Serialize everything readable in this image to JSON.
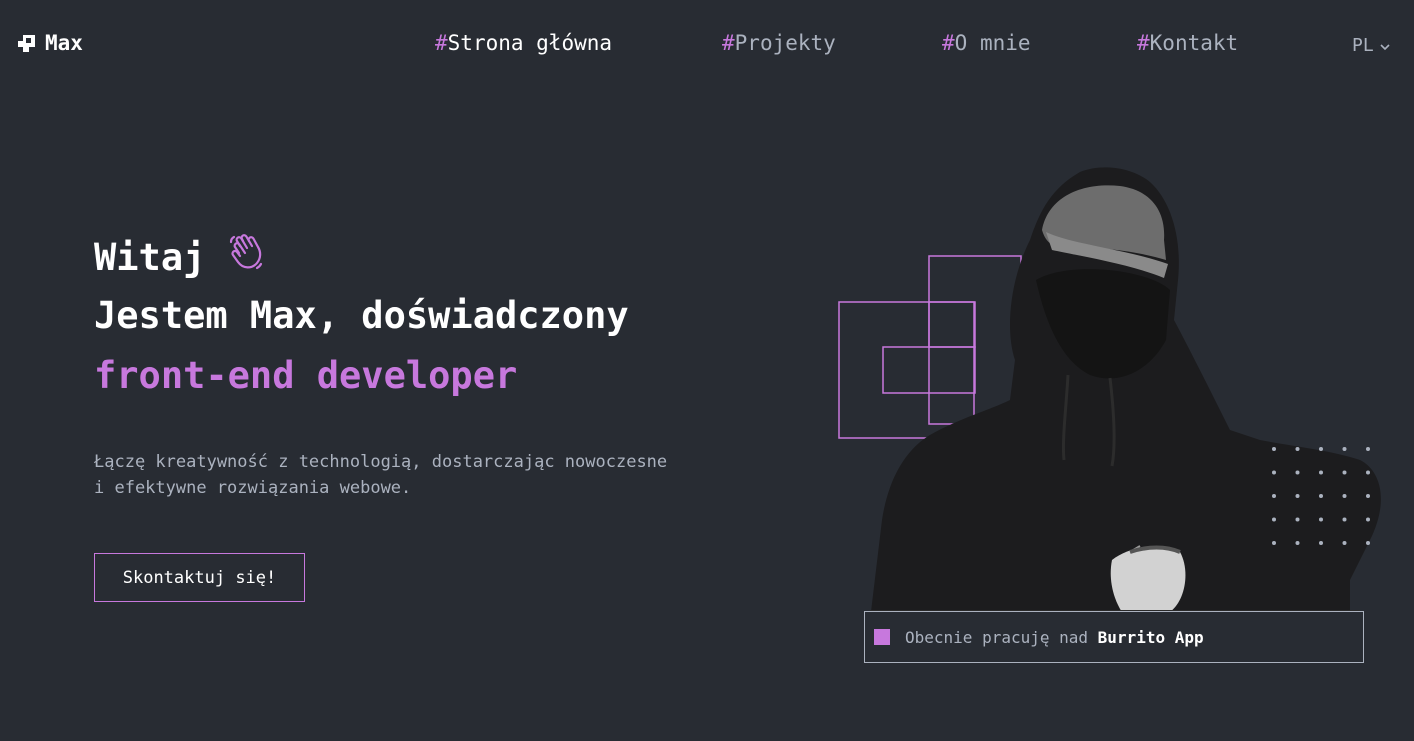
{
  "header": {
    "logo_text": "Max",
    "nav": [
      {
        "hash": "#",
        "label": "Strona główna"
      },
      {
        "hash": "#",
        "label": "Projekty"
      },
      {
        "hash": "#",
        "label": "O mnie"
      },
      {
        "hash": "#",
        "label": "Kontakt"
      }
    ],
    "language": "PL"
  },
  "hero": {
    "greeting": "Witaj",
    "line2": "Jestem Max, doświadczony",
    "line3": "front-end developer",
    "description_line1": "Łączę kreatywność z technologią, dostarczając nowoczesne",
    "description_line2": "i efektywne rozwiązania webowe.",
    "cta_label": "Skontaktuj się!"
  },
  "status": {
    "prefix": "Obecnie pracuję nad",
    "project": "Burrito App"
  },
  "icons": {
    "logo": "logo-icon",
    "wave": "waving-hand-icon",
    "lang": "chevron-down-icon"
  },
  "colors": {
    "background": "#282c33",
    "accent": "#c778dd",
    "text": "#abb2bf",
    "heading": "#ffffff"
  }
}
